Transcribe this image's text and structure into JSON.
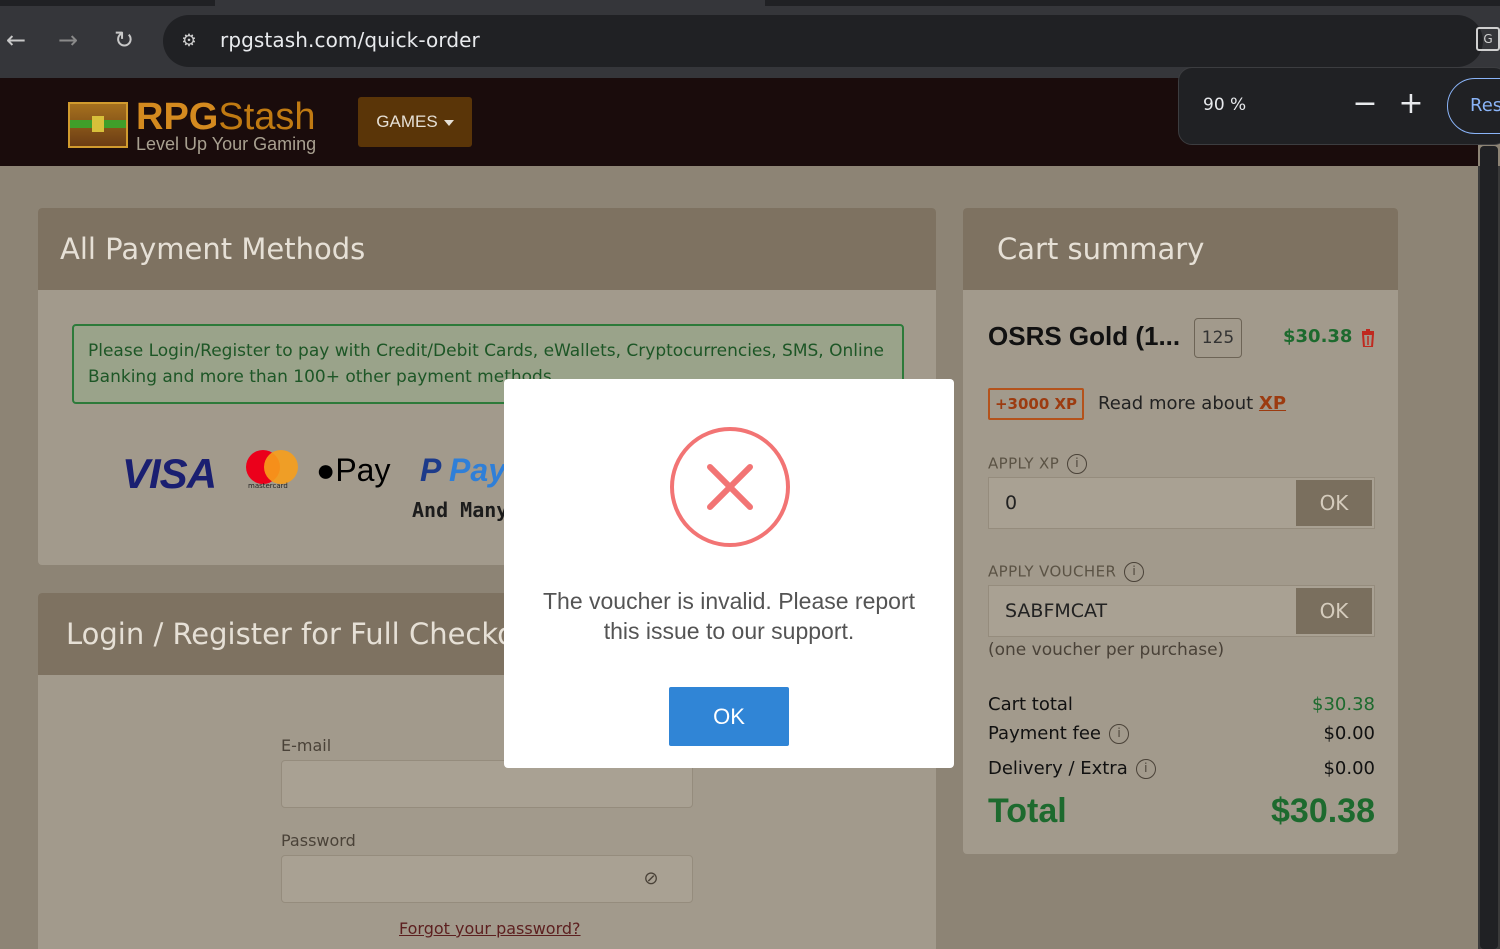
{
  "browser": {
    "url": "rpgstash.com/quick-order",
    "zoom": {
      "level": "90 %",
      "minus": "−",
      "plus": "+",
      "reset": "Res"
    }
  },
  "header": {
    "logo_rpg": "RPG",
    "logo_stash": "Stash",
    "logo_tagline": "Level Up Your Gaming",
    "games_button": "GAMES"
  },
  "payment_methods": {
    "title": "All Payment Methods",
    "notice": "Please Login/Register to pay with Credit/Debit Cards, eWallets, Cryptocurrencies, SMS, Online Banking and more than 100+ other payment methods",
    "logos": {
      "visa": "VISA",
      "mastercard": "mastercard",
      "applepay": "Pay",
      "paypal_a": "P",
      "paypal_b": "Pay"
    },
    "and_many": "And Many"
  },
  "login": {
    "title": "Login / Register for Full Checkout",
    "email_label": "E-mail",
    "password_label": "Password",
    "forgot": "Forgot your password?"
  },
  "cart": {
    "title": "Cart summary",
    "item": {
      "name": "OSRS Gold (1...",
      "qty": "125",
      "price": "$30.38"
    },
    "xp_badge": "+3000 XP",
    "xp_read": "Read more about",
    "xp_link": "XP",
    "apply_xp": {
      "label": "APPLY XP",
      "value": "0",
      "button": "OK"
    },
    "apply_voucher": {
      "label": "APPLY VOUCHER",
      "value": "SABFMCAT",
      "button": "OK"
    },
    "voucher_note": "(one voucher per purchase)",
    "cart_total": {
      "label": "Cart total",
      "value": "$30.38"
    },
    "payment_fee": {
      "label": "Payment fee",
      "value": "$0.00"
    },
    "delivery": {
      "label": "Delivery / Extra",
      "value": "$0.00"
    },
    "total": {
      "label": "Total",
      "value": "$30.38"
    }
  },
  "modal": {
    "message": "The voucher is invalid. Please report this issue to our support.",
    "ok": "OK"
  },
  "colors": {
    "header_bg": "#1a0c0c",
    "panel_head": "#7e7261",
    "panel_body": "#a29a8c",
    "price_green": "#1d6a2e",
    "error_red": "#f27474",
    "ok_blue": "#3085d6"
  }
}
